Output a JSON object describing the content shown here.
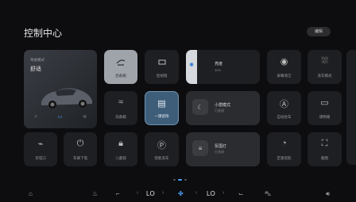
{
  "header": {
    "title": "控制中心",
    "edit_label": "编辑"
  },
  "car_card": {
    "mode_label": "驾驶模式",
    "mode_value": "舒适",
    "icons": [
      "⚡",
      "▭",
      "≋"
    ]
  },
  "tiles": {
    "rear_trunk": "后备箱",
    "front_trunk": "前备箱",
    "one_key_shade": "一键遮阳",
    "charge_port": "充电口",
    "power_off": "车辆下电",
    "child_lock": "儿童锁",
    "car_wash": "智能洗车",
    "screen_clean": "屏幕清洁",
    "car_wash_mode": "洗车模式",
    "auto_hold": "自动驻车",
    "storage": "储物箱",
    "cruise": "定速巡航",
    "screenshot": "截图",
    "tile_unknown": "后视镜"
  },
  "brightness": {
    "label": "亮度",
    "value": "30%"
  },
  "nap_mode": {
    "label": "小憩模式",
    "sub": "已关闭"
  },
  "ambient": {
    "label": "氛围灯",
    "sub": "已关闭"
  },
  "pager": {
    "pages": 3,
    "active": 2
  },
  "dock": {
    "left_temp": "LO",
    "right_temp": "LO"
  },
  "colors": {
    "accent": "#4aa3ff",
    "tile": "#1e1f22",
    "highlight": "#3e5d78"
  }
}
